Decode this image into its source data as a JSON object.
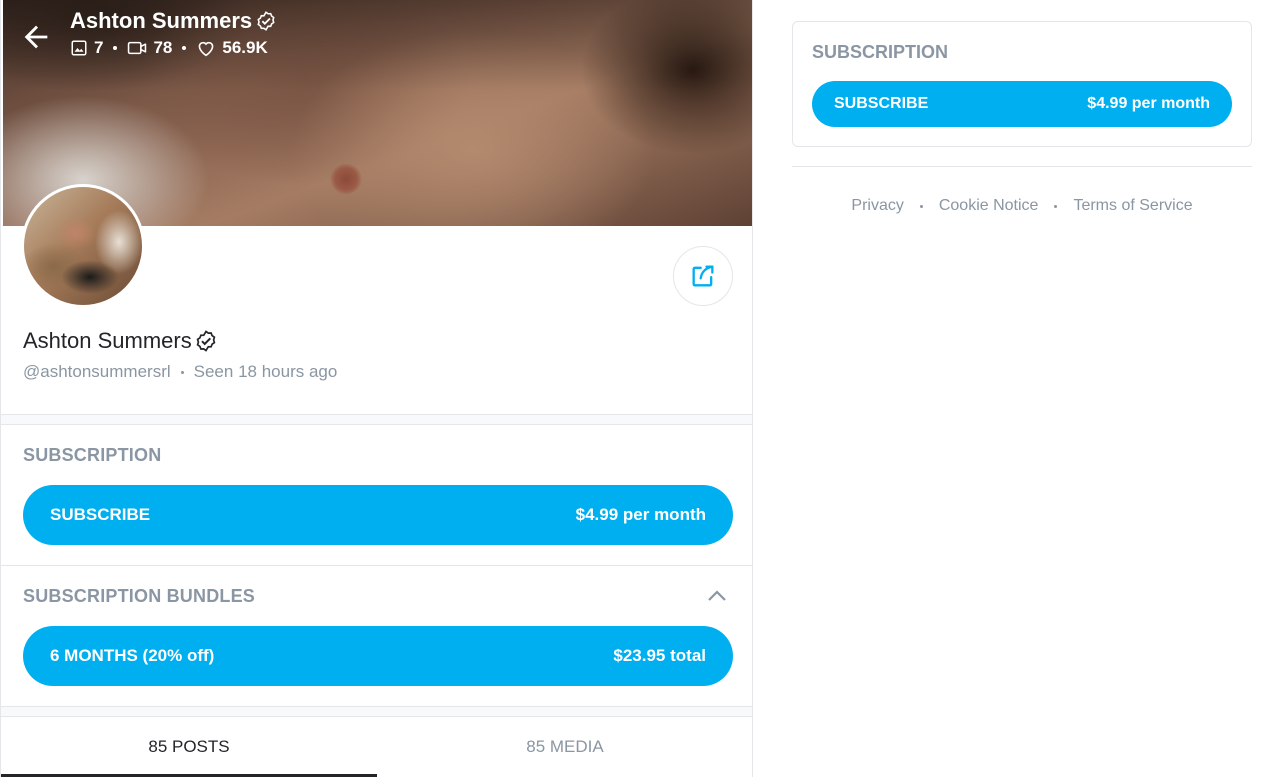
{
  "cover": {
    "name": "Ashton Summers",
    "stats": {
      "photos": "7",
      "videos": "78",
      "likes": "56.9K"
    }
  },
  "profile": {
    "name": "Ashton Summers",
    "handle": "@ashtonsummersrl",
    "seen_label": "Seen",
    "seen_time": "18 hours ago"
  },
  "subscription": {
    "label": "SUBSCRIPTION",
    "button_label": "SUBSCRIBE",
    "price": "$4.99 per month"
  },
  "bundles": {
    "label": "SUBSCRIPTION BUNDLES",
    "items": [
      {
        "label": "6 MONTHS (20% off)",
        "price": "$23.95 total"
      }
    ]
  },
  "tabs": [
    {
      "label": "85 POSTS",
      "active": true
    },
    {
      "label": "85 MEDIA",
      "active": false
    }
  ],
  "sidebar": {
    "subscription_label": "SUBSCRIPTION",
    "button_label": "SUBSCRIBE",
    "price": "$4.99 per month"
  },
  "footer": {
    "links": [
      "Privacy",
      "Cookie Notice",
      "Terms of Service"
    ]
  },
  "colors": {
    "accent": "#00aff0",
    "muted_text": "#8a96a3",
    "text": "#242529"
  },
  "icons": [
    "back-arrow-icon",
    "verified-badge-icon",
    "image-icon",
    "video-icon",
    "heart-icon",
    "share-icon",
    "chevron-up-icon"
  ]
}
